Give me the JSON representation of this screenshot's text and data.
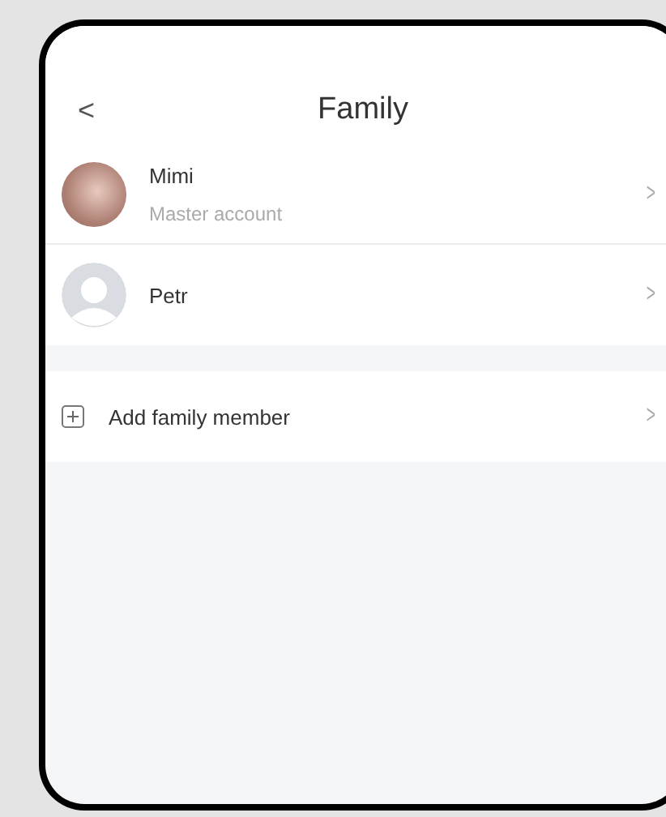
{
  "header": {
    "back": "<",
    "title": "Family"
  },
  "members": [
    {
      "name": "Mimi",
      "subtitle": "Master account",
      "kind": "photo",
      "chevron": ">"
    },
    {
      "name": "Petr",
      "kind": "default",
      "chevron": ">"
    }
  ],
  "add_row": {
    "label": "Add family member",
    "chevron": ">"
  }
}
